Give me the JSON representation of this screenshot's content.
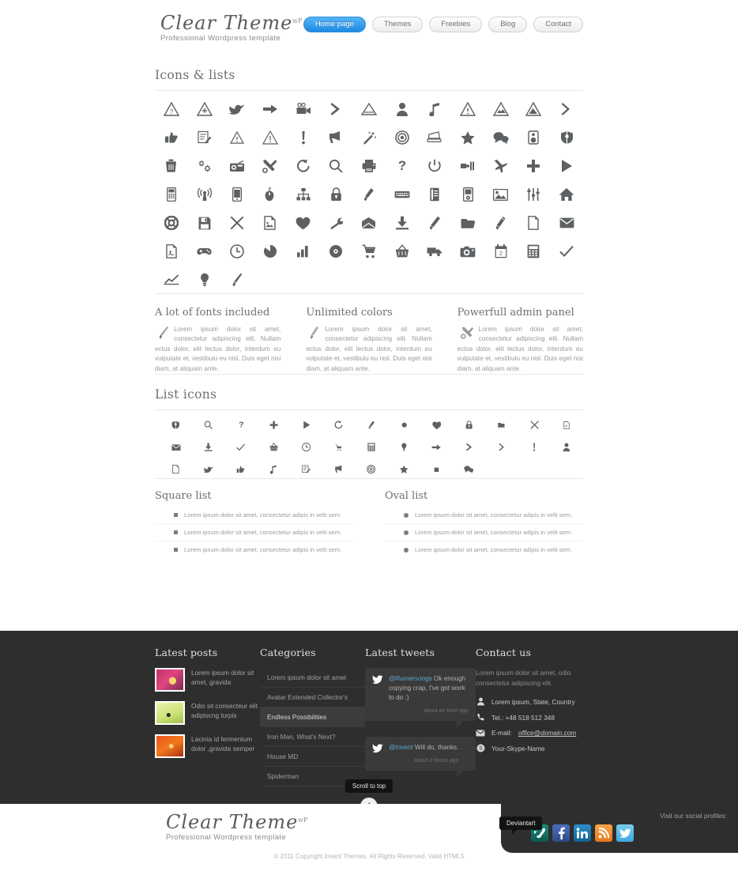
{
  "header": {
    "logo_main": "Clear Theme",
    "logo_sup": "wP",
    "logo_sub": "Professional Wordpress template",
    "nav": [
      {
        "label": "Home page",
        "active": true
      },
      {
        "label": "Themes",
        "active": false
      },
      {
        "label": "Freebies",
        "active": false
      },
      {
        "label": "Blog",
        "active": false
      },
      {
        "label": "Contact",
        "active": false
      }
    ]
  },
  "main": {
    "icons_title": "Icons & lists",
    "icon_names": [
      "warning-question-icon",
      "warning-plus-icon",
      "twitter-bird-icon",
      "arrow-right-icon",
      "video-camera-icon",
      "chevron-right-bold-icon",
      "triangle-outline-icon",
      "user-icon",
      "music-note-icon",
      "warning-exclam-icon",
      "warning-mountain-icon",
      "warning-peak-icon",
      "chevron-right-icon",
      "thumbs-up-icon",
      "note-edit-icon",
      "warning-small-icon",
      "warning-alert-icon",
      "exclamation-icon",
      "megaphone-icon",
      "magic-wand-icon",
      "target-icon",
      "scanner-icon",
      "star-icon",
      "chat-bubbles-icon",
      "speaker-icon",
      "shield-icon",
      "trash-icon",
      "gears-icon",
      "radio-icon",
      "tools-icon",
      "refresh-icon",
      "search-icon",
      "printer-icon",
      "question-icon",
      "power-icon",
      "plug-icon",
      "airplane-icon",
      "plus-icon",
      "play-icon",
      "mobile-keypad-icon",
      "wifi-signal-icon",
      "smartphone-icon",
      "mouse-icon",
      "sitemap-icon",
      "lock-icon",
      "usb-icon",
      "keyboard-icon",
      "book-icon",
      "ipod-icon",
      "image-icon",
      "sliders-icon",
      "home-icon",
      "lifebuoy-icon",
      "save-icon",
      "close-x-icon",
      "document-image-icon",
      "heart-icon",
      "wrench-icon",
      "open-mail-icon",
      "download-icon",
      "pencil-icon",
      "folder-open-icon",
      "marker-icon",
      "file-icon",
      "envelope-icon",
      "pdf-file-icon",
      "gamepad-icon",
      "clock-icon",
      "pie-chart-icon",
      "bar-chart-icon",
      "disc-icon",
      "shopping-cart-icon",
      "basket-icon",
      "truck-icon",
      "camera-icon",
      "calendar-icon",
      "calculator-icon",
      "check-icon",
      "line-chart-icon",
      "lightbulb-icon",
      "brush-icon"
    ],
    "features": [
      {
        "title": "A lot of fonts included",
        "icon": "brush-icon",
        "text": "Lorem ipsum dolor sit amet, consectetur adipiscing elit. Nullam ectus dolor, elit lectus dolor, interdum eu vulputate et, vestibulu eu nisl. Duis eget nisi diam, at aliquam ante."
      },
      {
        "title": "Unlimited colors",
        "icon": "pencil-icon",
        "text": "Lorem ipsum dolor sit amet, consectetur adipiscing elit. Nullam ectus dolor, elit lectus dolor, interdum eu vulputate et, vestibulu eu nisl. Duis eget nisi diam, at aliquam ante."
      },
      {
        "title": "Powerfull admin panel",
        "icon": "tools-icon",
        "text": "Lorem ipsum dolor sit amet, consectetur adipiscing elit. Nullam ectus dolor, elit lectus dolor, interdum eu vulputate et, vestibulu eu nisl. Duis eget nisi diam, at aliquam ante."
      }
    ],
    "list_icons_title": "List icons",
    "list_icon_names": [
      "shield-icon",
      "search-icon",
      "question-icon",
      "plus-icon",
      "play-icon",
      "refresh-icon",
      "usb-icon",
      "circle-icon",
      "heart-icon",
      "lock-icon",
      "folder-icon",
      "close-x-icon",
      "document-icon",
      "envelope-icon",
      "download-icon",
      "check-icon",
      "basket-icon",
      "clock-icon",
      "cart-icon",
      "calculator-icon",
      "lightbulb-icon",
      "arrow-right-icon",
      "chevron-right-bold-icon",
      "chevron-right-icon",
      "exclamation-icon",
      "user-icon",
      "file-icon",
      "twitter-bird-icon",
      "thumbs-up-icon",
      "music-note-icon",
      "note-edit-icon",
      "megaphone-icon",
      "target-icon",
      "star-icon",
      "square-icon",
      "chat-bubbles-icon"
    ],
    "square_list": {
      "title": "Square list",
      "items": [
        "Lorem ipsum dolor sit amet, consectetur adipis in velit sem.",
        "Lorem ipsum dolor sit amet, consectetur adipis in velit sem.",
        "Lorem ipsum dolor sit amet, consectetur adipis in velit sem."
      ]
    },
    "oval_list": {
      "title": "Oval list",
      "items": [
        "Lorem ipsum dolor sit amet, consectetur adipis in velit sem.",
        "Lorem ipsum dolor sit amet, consectetur adipis in velit sem.",
        "Lorem ipsum dolor sit amet, consectetur adipis in velit sem."
      ]
    }
  },
  "footer": {
    "latest_posts": {
      "title": "Latest posts",
      "items": [
        "Lorem ipsum dolor sit amet, gravida",
        "Odio sit consecteur elit adipiscng turpis",
        "Lacinia id fermentum dolor ,gravida semper"
      ]
    },
    "categories": {
      "title": "Categories",
      "items": [
        {
          "label": "Lorem ipsum dolor sit amet",
          "active": false
        },
        {
          "label": "Avatar Extended Collector's",
          "active": false
        },
        {
          "label": "Endless Possibilities",
          "active": true
        },
        {
          "label": "Iron Man, What's Next?",
          "active": false
        },
        {
          "label": "House MD",
          "active": false
        },
        {
          "label": "Spiderman",
          "active": false
        }
      ]
    },
    "latest_tweets": {
      "title": "Latest tweets",
      "items": [
        {
          "handle": "@Rumersongs",
          "text": " Ok enough copying crap, I've got work to do :)",
          "time": "about an hour ago"
        },
        {
          "handle": "@Invent",
          "text": " Will do, thanks.",
          "time": "about 2 hours ago"
        }
      ]
    },
    "contact": {
      "title": "Contact us",
      "lead": "Lorem ipsum dolor sit amet, odio consectetur adipiscing elit.",
      "rows": [
        {
          "icon": "user-icon",
          "label": "Lorem ipsum, State, Country",
          "link": ""
        },
        {
          "icon": "phone-icon",
          "label": "Tel.: +48 518 512 348",
          "link": ""
        },
        {
          "icon": "mail-icon",
          "label": "E-mail: ",
          "link": "office@domain.com"
        },
        {
          "icon": "skype-icon",
          "label": "Your-Skype-Name",
          "link": ""
        }
      ]
    },
    "scroll_to_top": "Scroll to top"
  },
  "bottom": {
    "logo_main": "Clear Theme",
    "logo_sup": "wP",
    "logo_sub": "Professional Wordpress template",
    "copyright": "© 2011 Copyright Invent Themes. All Rights Reserved. Valid HTML5",
    "social_label": "Visit our social profiles:",
    "deviantart_tooltip": "Deviantart",
    "social": [
      {
        "name": "deviantart",
        "letter": "D",
        "color": "#0d6b5e"
      },
      {
        "name": "facebook",
        "letter": "f",
        "color": "#3b5998"
      },
      {
        "name": "linkedin",
        "letter": "in",
        "color": "#1a7bb9"
      },
      {
        "name": "rss",
        "letter": "R",
        "color": "#f08a1c"
      },
      {
        "name": "twitter",
        "letter": "t",
        "color": "#57b8e8"
      }
    ]
  },
  "colors": {
    "accent": "#1e8ae0",
    "footer_bg": "#2e2e2e",
    "icon": "#5d6164",
    "text": "#9a9a9a"
  }
}
